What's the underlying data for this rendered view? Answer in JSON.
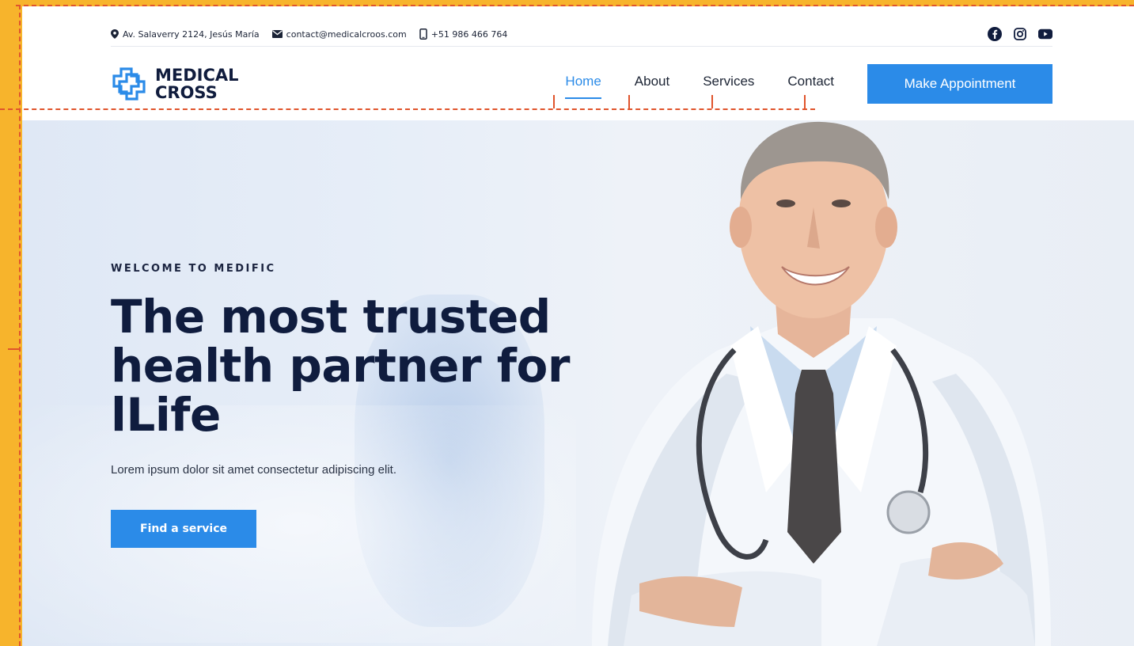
{
  "topbar": {
    "address": "Av. Salaverry 2124, Jesús María",
    "email": "contact@medicalcroos.com",
    "phone": "+51 986 466 764",
    "socials": [
      "facebook-icon",
      "instagram-icon",
      "youtube-icon"
    ]
  },
  "brand": {
    "line1": "MEDICAL",
    "line2": "CROSS"
  },
  "nav": {
    "items": [
      {
        "label": "Home",
        "active": true
      },
      {
        "label": "About",
        "active": false
      },
      {
        "label": "Services",
        "active": false
      },
      {
        "label": "Contact",
        "active": false
      }
    ],
    "cta_label": "Make Appointment"
  },
  "hero": {
    "eyebrow": "WELCOME TO MEDIFIC",
    "headline_line1": "The most trusted",
    "headline_line2": "health partner for",
    "headline_line3": "lLife",
    "subtext": "Lorem ipsum dolor sit amet consectetur adipiscing elit.",
    "cta_label": "Find a service"
  },
  "colors": {
    "accent": "#2b8be8",
    "heading": "#0f1c3e",
    "frame": "#f7b42c",
    "annotation": "#e0542c"
  }
}
